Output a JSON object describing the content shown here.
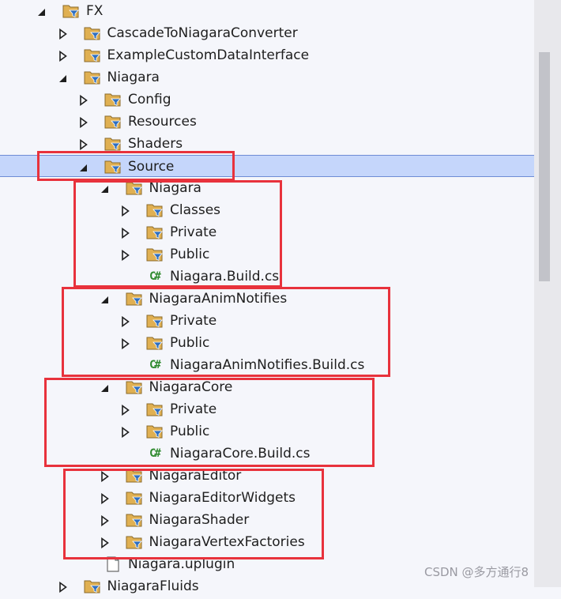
{
  "tree": {
    "rows": [
      {
        "label": "FX",
        "depth": 0,
        "arrow": "expanded",
        "icon": "filter-folder-icon"
      },
      {
        "label": "CascadeToNiagaraConverter",
        "depth": 1,
        "arrow": "collapsed",
        "icon": "filter-folder-icon"
      },
      {
        "label": "ExampleCustomDataInterface",
        "depth": 1,
        "arrow": "collapsed",
        "icon": "filter-folder-icon"
      },
      {
        "label": "Niagara",
        "depth": 1,
        "arrow": "expanded",
        "icon": "filter-folder-icon"
      },
      {
        "label": "Config",
        "depth": 2,
        "arrow": "collapsed",
        "icon": "filter-folder-icon"
      },
      {
        "label": "Resources",
        "depth": 2,
        "arrow": "collapsed",
        "icon": "filter-folder-icon"
      },
      {
        "label": "Shaders",
        "depth": 2,
        "arrow": "collapsed",
        "icon": "filter-folder-icon"
      },
      {
        "label": "Source",
        "depth": 2,
        "arrow": "expanded",
        "icon": "filter-folder-icon",
        "selected": true
      },
      {
        "label": "Niagara",
        "depth": 3,
        "arrow": "expanded",
        "icon": "filter-folder-icon"
      },
      {
        "label": "Classes",
        "depth": 4,
        "arrow": "collapsed",
        "icon": "filter-folder-icon"
      },
      {
        "label": "Private",
        "depth": 4,
        "arrow": "collapsed",
        "icon": "filter-folder-icon"
      },
      {
        "label": "Public",
        "depth": 4,
        "arrow": "collapsed",
        "icon": "filter-folder-icon"
      },
      {
        "label": "Niagara.Build.cs",
        "depth": 4,
        "arrow": "none",
        "icon": "csharp-file-icon"
      },
      {
        "label": "NiagaraAnimNotifies",
        "depth": 3,
        "arrow": "expanded",
        "icon": "filter-folder-icon"
      },
      {
        "label": "Private",
        "depth": 4,
        "arrow": "collapsed",
        "icon": "filter-folder-icon"
      },
      {
        "label": "Public",
        "depth": 4,
        "arrow": "collapsed",
        "icon": "filter-folder-icon"
      },
      {
        "label": "NiagaraAnimNotifies.Build.cs",
        "depth": 4,
        "arrow": "none",
        "icon": "csharp-file-icon"
      },
      {
        "label": "NiagaraCore",
        "depth": 3,
        "arrow": "expanded",
        "icon": "filter-folder-icon"
      },
      {
        "label": "Private",
        "depth": 4,
        "arrow": "collapsed",
        "icon": "filter-folder-icon"
      },
      {
        "label": "Public",
        "depth": 4,
        "arrow": "collapsed",
        "icon": "filter-folder-icon"
      },
      {
        "label": "NiagaraCore.Build.cs",
        "depth": 4,
        "arrow": "none",
        "icon": "csharp-file-icon"
      },
      {
        "label": "NiagaraEditor",
        "depth": 3,
        "arrow": "collapsed",
        "icon": "filter-folder-icon"
      },
      {
        "label": "NiagaraEditorWidgets",
        "depth": 3,
        "arrow": "collapsed",
        "icon": "filter-folder-icon"
      },
      {
        "label": "NiagaraShader",
        "depth": 3,
        "arrow": "collapsed",
        "icon": "filter-folder-icon"
      },
      {
        "label": "NiagaraVertexFactories",
        "depth": 3,
        "arrow": "collapsed",
        "icon": "filter-folder-icon"
      },
      {
        "label": "Niagara.uplugin",
        "depth": 2,
        "arrow": "none",
        "icon": "file-icon"
      },
      {
        "label": "NiagaraFluids",
        "depth": 1,
        "arrow": "collapsed",
        "icon": "filter-folder-icon"
      }
    ],
    "cs_glyph": "C#"
  },
  "watermark": "CSDN @多方通行8",
  "colors": {
    "selection": "#c5d6fb",
    "highlight_box": "#e8323c",
    "folder": "#d9a441",
    "filter": "#2f6fc0"
  }
}
